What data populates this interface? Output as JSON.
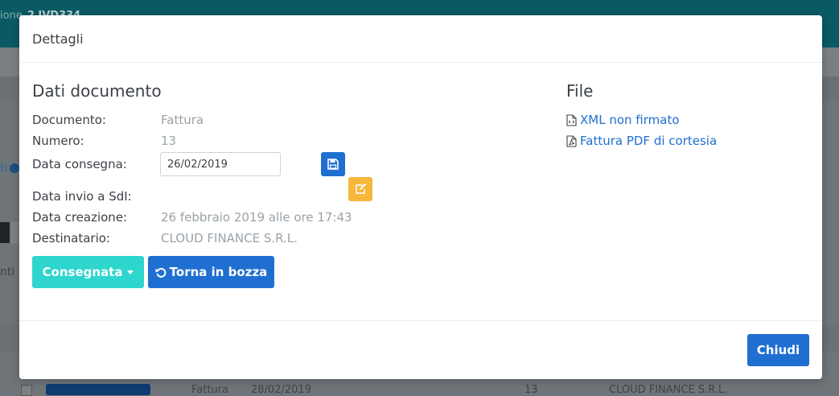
{
  "background": {
    "breadcrumb_prefix": "ione",
    "breadcrumb_current": "2 IVD334",
    "left_link": "ti",
    "left_text": "nti",
    "row": {
      "doc_type": "Fattura",
      "date": "28/02/2019",
      "number": "13",
      "recipient": "CLOUD FINANCE S.R.L."
    }
  },
  "modal": {
    "title": "Dettagli",
    "dati": {
      "heading": "Dati documento",
      "documento_label": "Documento:",
      "documento_value": "Fattura",
      "numero_label": "Numero:",
      "numero_value": "13",
      "consegna_label": "Data consegna:",
      "consegna_value": "26/02/2019",
      "invio_label": "Data invio a SdI:",
      "invio_value": "",
      "creazione_label": "Data creazione:",
      "creazione_value": "26 febbraio 2019 alle ore 17:43",
      "destinatario_label": "Destinatario:",
      "destinatario_value": "CLOUD FINANCE S.R.L."
    },
    "actions": {
      "status_label": "Consegnata",
      "torna_label": "Torna in bozza"
    },
    "file": {
      "heading": "File",
      "xml_label": "XML non firmato",
      "pdf_label": "Fattura PDF di cortesia"
    },
    "footer": {
      "close_label": "Chiudi"
    }
  },
  "icons": {
    "save": "save-icon",
    "edit": "edit-icon",
    "undo": "undo-icon",
    "xml": "file-code-icon",
    "pdf": "file-pdf-icon"
  },
  "colors": {
    "primary": "#1f6fd1",
    "info": "#2ed6cd",
    "warning": "#f6b73a",
    "topbar": "#0a5a63"
  }
}
